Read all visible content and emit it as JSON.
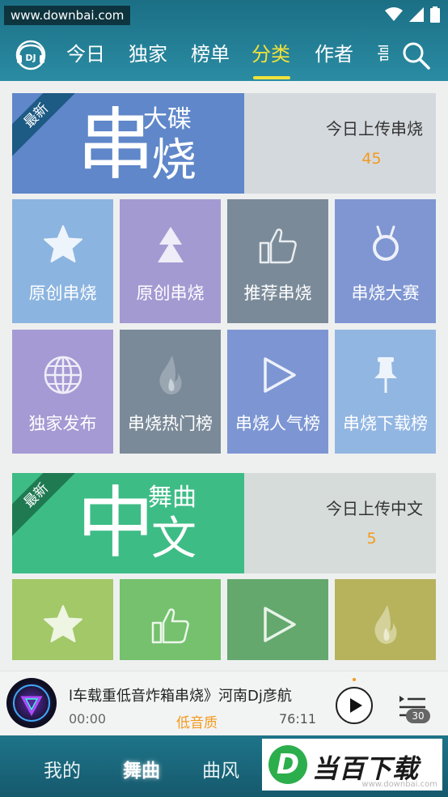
{
  "status_bar": {
    "watermark_url": "www.downbai.com"
  },
  "nav": {
    "tabs": [
      {
        "label": "今日",
        "active": false
      },
      {
        "label": "独家",
        "active": false
      },
      {
        "label": "榜单",
        "active": false
      },
      {
        "label": "分类",
        "active": true
      },
      {
        "label": "作者",
        "active": false
      }
    ],
    "partial_tab": "哥",
    "logo_text": "DJ"
  },
  "colors": {
    "header": "#2a8ca3",
    "active_tab": "#f3e23a",
    "accent_orange": "#f39a1e",
    "banner1": "#5f87c9",
    "banner2": "#3ebc86"
  },
  "section1": {
    "badge": "最新",
    "big_char": "串",
    "small_top": "大碟",
    "small_bottom": "烧",
    "right_title": "今日上传串烧",
    "right_count": "45",
    "tiles": [
      {
        "label": "原创串烧",
        "icon": "star-icon",
        "color": "#8cb4e0"
      },
      {
        "label": "原创串烧",
        "icon": "tree-icon",
        "color": "#a49ad2"
      },
      {
        "label": "推荐串烧",
        "icon": "thumbs-up-icon",
        "color": "#7a8a98"
      },
      {
        "label": "串烧大赛",
        "icon": "medal-icon",
        "color": "#7f96d2"
      },
      {
        "label": "独家发布",
        "icon": "globe-icon",
        "color": "#a59ad3"
      },
      {
        "label": "串烧热门榜",
        "icon": "flame-icon",
        "color": "#7b8a98"
      },
      {
        "label": "串烧人气榜",
        "icon": "play-triangle-icon",
        "color": "#7d96d3"
      },
      {
        "label": "串烧下载榜",
        "icon": "pushpin-icon",
        "color": "#92b6e2"
      }
    ]
  },
  "section2": {
    "badge": "最新",
    "big_char": "中",
    "small_top": "舞曲",
    "small_bottom": "文",
    "right_title": "今日上传中文",
    "right_count": "5",
    "tiles": [
      {
        "icon": "star-icon",
        "color": "#a3c868"
      },
      {
        "icon": "thumbs-up-icon",
        "color": "#75c16e"
      },
      {
        "icon": "play-triangle-icon",
        "color": "#64a86d"
      },
      {
        "icon": "flame-icon",
        "color": "#b6b35c"
      }
    ]
  },
  "player": {
    "song_title": "l车载重低音炸箱串烧》河南Dj彦航",
    "time_current": "00:00",
    "quality": "低音质",
    "time_total": "76:11",
    "playlist_count": "30"
  },
  "bottom_nav": {
    "items": [
      {
        "label": "我的",
        "active": false
      },
      {
        "label": "舞曲",
        "active": true
      },
      {
        "label": "曲风",
        "active": false
      }
    ]
  },
  "brand": {
    "name": "当百下载",
    "letter": "D",
    "sub": "www.downbai.com"
  }
}
